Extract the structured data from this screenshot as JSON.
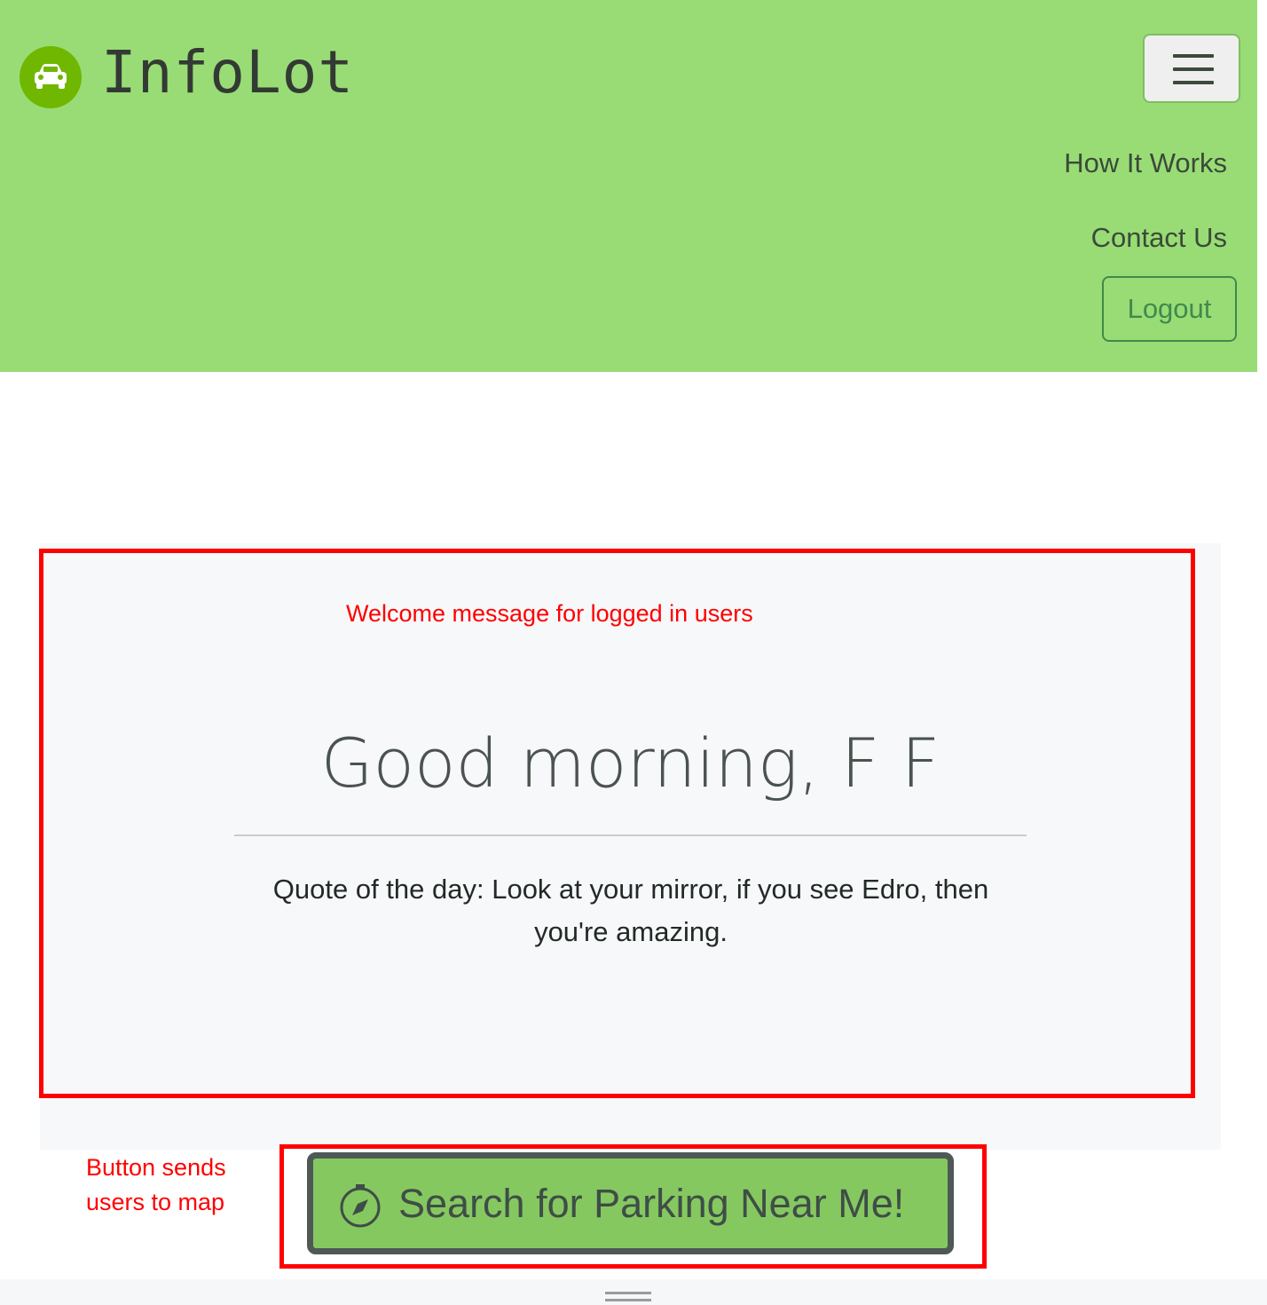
{
  "navbar": {
    "brand_name": "InfoLot",
    "logo_icon": "car-icon",
    "menu_icon": "hamburger-menu-icon",
    "links": [
      "How It Works",
      "Contact Us"
    ],
    "logout_label": "Logout"
  },
  "welcome": {
    "greeting": "Good morning, F F",
    "quote": "Quote of the day: Look at your mirror, if you see Edro, then you're amazing."
  },
  "search": {
    "label": "Search for Parking Near Me!",
    "icon": "compass-icon"
  },
  "annotations": {
    "welcome_note": "Welcome message for logged in users",
    "button_note_line1": "Button sends",
    "button_note_line2": "users to map"
  },
  "colors": {
    "navbar_bg": "#99dc76",
    "logo_bg": "#6fb700",
    "button_bg": "#85c860",
    "button_border": "#4e5956",
    "annotation": "#ff0000"
  }
}
